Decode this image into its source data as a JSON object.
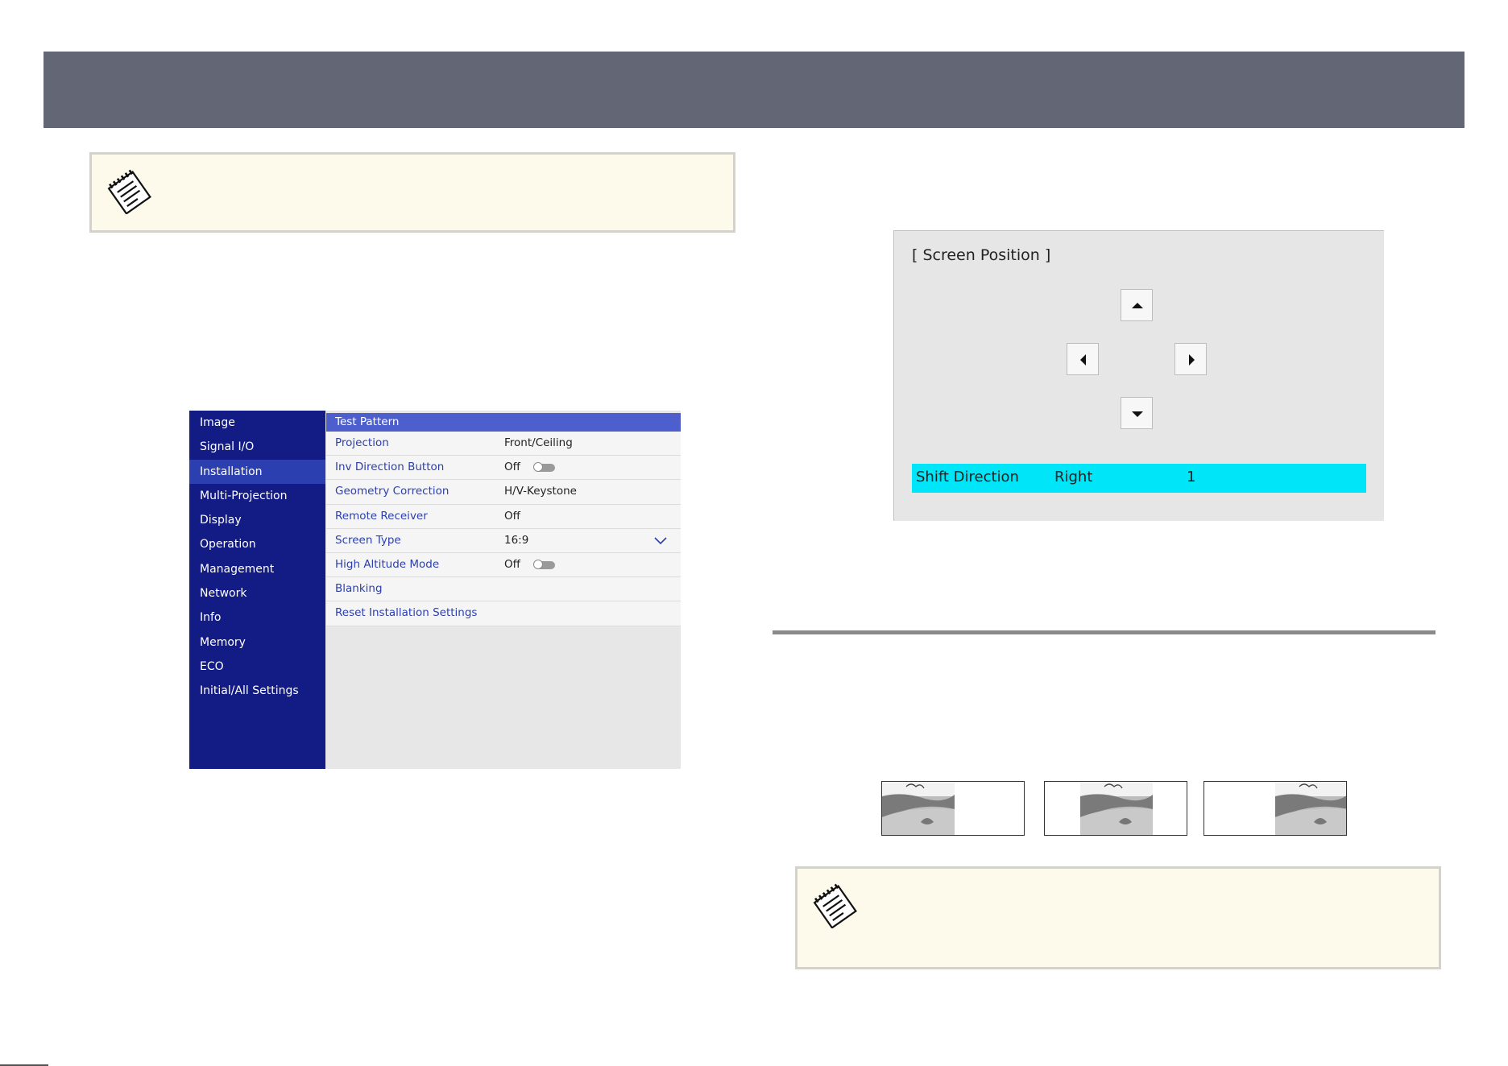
{
  "icons": {
    "note": "note-pad-icon"
  },
  "menu": {
    "sidebar": [
      {
        "label": "Image",
        "active": false
      },
      {
        "label": "Signal I/O",
        "active": false
      },
      {
        "label": "Installation",
        "active": true
      },
      {
        "label": "Multi-Projection",
        "active": false
      },
      {
        "label": "Display",
        "active": false
      },
      {
        "label": "Operation",
        "active": false
      },
      {
        "label": "Management",
        "active": false
      },
      {
        "label": "Network",
        "active": false
      },
      {
        "label": "Info",
        "active": false
      },
      {
        "label": "Memory",
        "active": false
      },
      {
        "label": "ECO",
        "active": false
      },
      {
        "label": "Initial/All Settings",
        "active": false
      }
    ],
    "rows": [
      {
        "label": "Test Pattern",
        "value": ""
      },
      {
        "label": "Projection",
        "value": "Front/Ceiling"
      },
      {
        "label": "Inv Direction Button",
        "value": "Off",
        "toggle": true
      },
      {
        "label": "Geometry Correction",
        "value": "H/V-Keystone"
      },
      {
        "label": "Remote Receiver",
        "value": "Off"
      },
      {
        "label": "Screen Type",
        "value": "16:9",
        "dropdown": true
      },
      {
        "label": "High Altitude Mode",
        "value": "Off",
        "toggle": true
      },
      {
        "label": "Blanking",
        "value": ""
      },
      {
        "label": "Reset Installation Settings",
        "value": ""
      }
    ]
  },
  "screen_position": {
    "title": "[ Screen Position ]",
    "shift_label": "Shift Direction",
    "shift_value": "Right",
    "shift_amount": "1",
    "buttons": [
      "up",
      "left",
      "right",
      "down"
    ]
  },
  "thumbnails": [
    "image-shifted-left",
    "image-centered",
    "image-shifted-right"
  ],
  "colors": {
    "header": "#636775",
    "sidebar": "#131b84",
    "sidebar_active": "#2c3fb0",
    "selected_row": "#4d5fcd",
    "shift_highlight": "#00e5f7",
    "note_background": "#fdfaeb"
  }
}
